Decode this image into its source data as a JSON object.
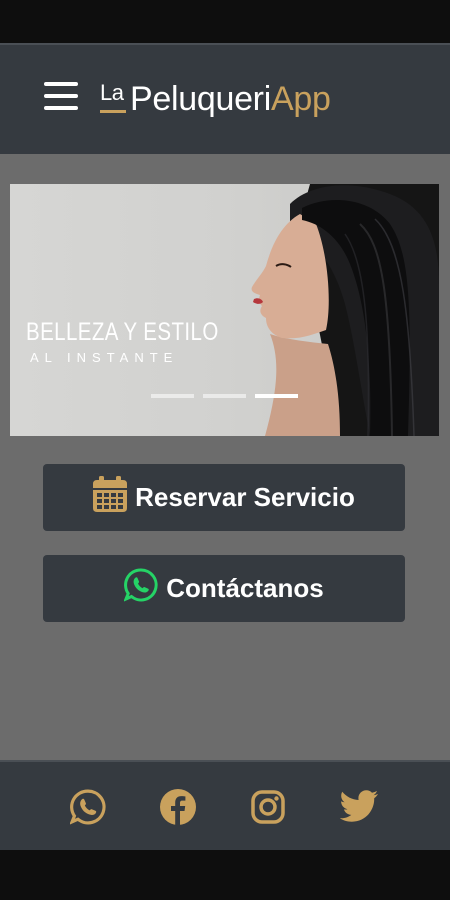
{
  "header": {
    "logo_prefix": "La",
    "logo_main": "Peluqueri",
    "logo_accent": "App",
    "menu_icon": "hamburger-menu-icon"
  },
  "banner": {
    "title": "BELLEZA Y ESTILO",
    "subtitle": "AL INSTANTE",
    "slide_count": 3,
    "active_slide": 3
  },
  "actions": {
    "reserve_label": "Reservar Servicio",
    "reserve_icon": "calendar-icon",
    "contact_label": "Contáctanos",
    "contact_icon": "whatsapp-icon"
  },
  "footer": {
    "social_icons": [
      "whatsapp-icon",
      "facebook-icon",
      "instagram-icon",
      "twitter-icon"
    ]
  },
  "colors": {
    "accent": "#c9a15d",
    "bar": "#353a40",
    "background": "#6c6c6c",
    "whatsapp_green": "#25d366"
  }
}
